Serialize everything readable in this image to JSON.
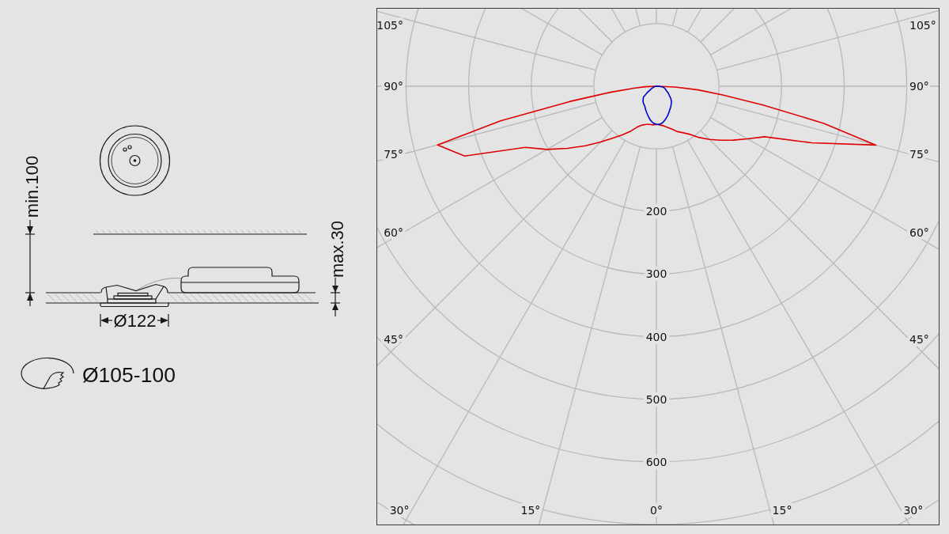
{
  "drawing": {
    "height_dimension": "min.100",
    "depth_dimension": "max.30",
    "diameter_dimension": "Ø122",
    "cutout_dimension": "Ø105-100"
  },
  "polar_diagram": {
    "left_angle_labels": [
      "105°",
      "90°",
      "75°",
      "60°",
      "45°"
    ],
    "right_angle_labels": [
      "105°",
      "90°",
      "75°",
      "60°",
      "45°"
    ],
    "intensity_labels": [
      "200",
      "300",
      "400",
      "500",
      "600"
    ],
    "bottom_angle_labels": [
      "30°",
      "15°",
      "0°",
      "15°",
      "30°"
    ]
  }
}
